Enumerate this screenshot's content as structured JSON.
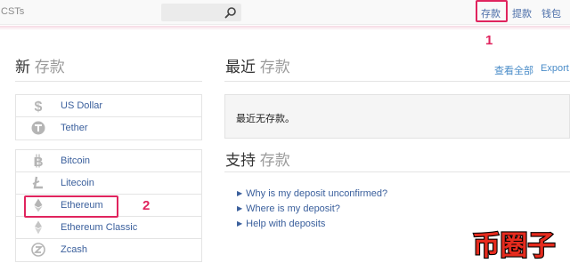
{
  "header": {
    "brand": "CSTs",
    "search": {
      "value": "",
      "placeholder": ""
    },
    "nav": {
      "deposit": "存款",
      "withdraw": "提款",
      "wallet": "钱包"
    }
  },
  "annotations": {
    "step1": "1",
    "step2": "2"
  },
  "new_deposit": {
    "title_main": "新",
    "title_sub": "存款",
    "fiat": [
      {
        "label": "US Dollar",
        "icon": "dollar-icon"
      },
      {
        "label": "Tether",
        "icon": "tether-icon"
      }
    ],
    "crypto": [
      {
        "label": "Bitcoin",
        "icon": "bitcoin-icon"
      },
      {
        "label": "Litecoin",
        "icon": "litecoin-icon"
      },
      {
        "label": "Ethereum",
        "icon": "ethereum-icon"
      },
      {
        "label": "Ethereum Classic",
        "icon": "ethereum-classic-icon"
      },
      {
        "label": "Zcash",
        "icon": "zcash-icon"
      }
    ]
  },
  "recent": {
    "title_main": "最近",
    "title_sub": "存款",
    "view_all": "查看全部",
    "export": "Export",
    "empty": "最近无存款。"
  },
  "support": {
    "title_main": "支持",
    "title_sub": "存款",
    "links": [
      "Why is my deposit unconfirmed?",
      "Where is my deposit?",
      "Help with deposits"
    ]
  },
  "watermark": {
    "text": "币圈子"
  },
  "colors": {
    "link": "#3a5f9c",
    "highlight": "#e0245e",
    "icon_gray": "#b5b5b5"
  }
}
